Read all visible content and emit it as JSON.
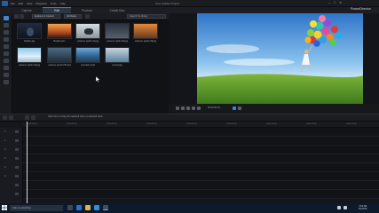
{
  "window": {
    "menu": [
      "File",
      "Edit",
      "View",
      "Playback",
      "Tools",
      "Help"
    ],
    "title": "New Untitled Project",
    "brand": "PowerDirector"
  },
  "modes": [
    "Capture",
    "Edit",
    "Produce",
    "Create Disc"
  ],
  "library": {
    "filter_label": "Explorer & Content",
    "filter2_label": "All Media",
    "search_placeholder": "Search the library",
    "items": [
      {
        "label": "balloon.jpg"
      },
      {
        "label": "Beach.wmv"
      },
      {
        "label": "extreme sports 01.jpg"
      },
      {
        "label": "extreme sports 02.jpg"
      },
      {
        "label": "extreme sports 03.jpg"
      },
      {
        "label": "extreme sports 04.jpg"
      },
      {
        "label": "extreme sports 05.mp4"
      },
      {
        "label": "mountain.mp4"
      },
      {
        "label": "sunset.jpg"
      }
    ]
  },
  "timeline": {
    "hint": "Click here or drag the selected clip to a selected track.",
    "ruler": [
      "00:00:00:00",
      "00:00:10:00",
      "00:00:20:00",
      "00:00:30:00",
      "00:00:40:00",
      "00:00:50:00",
      "00:01:00:00",
      "00:01:10:00",
      "00:01:20:00"
    ],
    "tracks": [
      "1.",
      "1.",
      "2.",
      "2.",
      "3.",
      "3.",
      "",
      "",
      ""
    ]
  },
  "preview": {
    "timecode": "00:00:00:00",
    "mode_labels": [
      "Clip",
      "Movie"
    ]
  },
  "taskbar": {
    "search": "Ask me anything",
    "time": "4:02 AM",
    "date": "5/1/2016"
  }
}
